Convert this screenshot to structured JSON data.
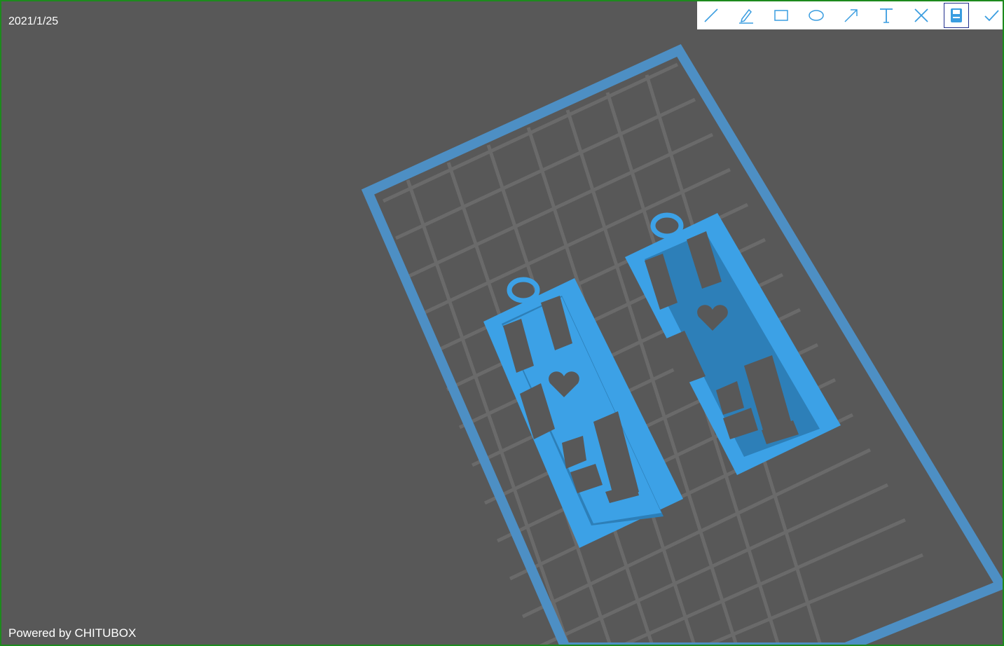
{
  "viewport": {
    "date": "2021/1/25",
    "powered_by": "Powered by CHITUBOX"
  },
  "toolbar": {
    "tools": [
      {
        "name": "line",
        "icon": "line-icon"
      },
      {
        "name": "pen",
        "icon": "pen-icon"
      },
      {
        "name": "rectangle",
        "icon": "rectangle-icon"
      },
      {
        "name": "ellipse",
        "icon": "ellipse-icon"
      },
      {
        "name": "arrow",
        "icon": "arrow-icon"
      },
      {
        "name": "text",
        "icon": "text-icon"
      },
      {
        "name": "cancel",
        "icon": "close-icon"
      },
      {
        "name": "save",
        "icon": "save-icon",
        "active": true
      },
      {
        "name": "confirm",
        "icon": "check-icon"
      }
    ]
  },
  "colors": {
    "background": "#585858",
    "frame_border": "#1d8a1d",
    "platform": "#4d8fc4",
    "grid": "#6a6a6a",
    "model": "#3ca1e6",
    "tool_icon": "#3a9de0"
  }
}
